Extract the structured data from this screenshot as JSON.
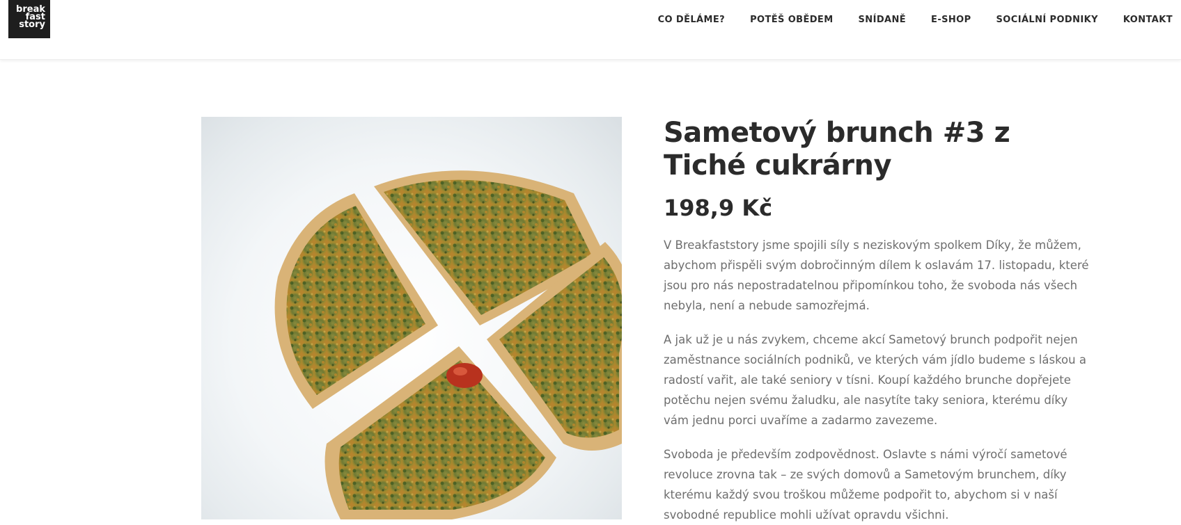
{
  "header": {
    "logo_lines": [
      "break",
      "fast",
      "story"
    ],
    "nav": [
      {
        "label": "CO DĚLÁME?"
      },
      {
        "label": "POTĚŠ OBĚDEM"
      },
      {
        "label": "SNÍDANĚ"
      },
      {
        "label": "E-SHOP"
      },
      {
        "label": "SOCIÁLNÍ PODNIKY"
      },
      {
        "label": "KONTAKT"
      }
    ]
  },
  "product": {
    "title": "Sametový brunch #3 z Tiché cukrárny",
    "price": "198,9 Kč",
    "description": [
      "V Breakfaststory jsme spojili síly s neziskovým spolkem Díky, že můžem, abychom přispěli svým dobročinným dílem k oslavám 17. listopadu, které jsou pro nás nepostradatelnou připomínkou toho, že svoboda nás všech nebyla, není a nebude samozřejmá.",
      "A jak už je u nás zvykem, chceme akcí Sametový brunch podpořit nejen zaměstnance sociálních podniků, ve kterých vám jídlo budeme s láskou a radostí vařit, ale také seniory v tísni. Koupí každého brunche dopřejete potěchu nejen svému žaludku, ale nasytíte taky seniora, kterému díky vám jednu porci uvaříme a zadarmo zavezeme.",
      "Svoboda je především zodpovědnost. Oslavte s námi výročí sametové revoluce zrovna tak – ze svých domovů a Sametovým brunchem, díky kterému každý svou troškou můžeme podpořit to, abychom si v naší svobodné republice mohli užívat opravdu všichni."
    ],
    "image_icon": "quiche-photo"
  },
  "colors": {
    "text": "#2b2b2b",
    "body_text": "#6e6e6e",
    "logo_bg": "#1e1e1e"
  }
}
